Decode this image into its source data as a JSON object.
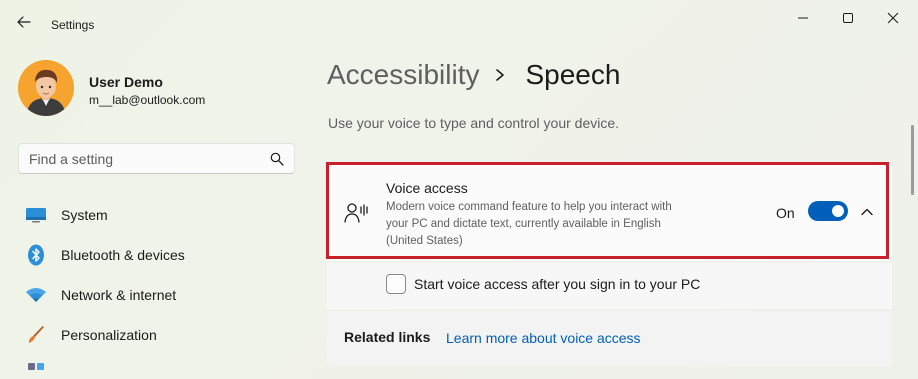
{
  "window": {
    "title": "Settings",
    "back_icon": "back-arrow-icon",
    "minimize_icon": "minimize-icon",
    "maximize_icon": "maximize-icon",
    "close_icon": "close-icon"
  },
  "user": {
    "name": "User Demo",
    "email": "m__lab@outlook.com"
  },
  "search": {
    "placeholder": "Find a setting",
    "icon": "search-icon"
  },
  "sidebar": {
    "items": [
      {
        "label": "System",
        "icon": "system-icon"
      },
      {
        "label": "Bluetooth & devices",
        "icon": "bluetooth-icon"
      },
      {
        "label": "Network & internet",
        "icon": "wifi-icon"
      },
      {
        "label": "Personalization",
        "icon": "brush-icon"
      }
    ]
  },
  "breadcrumb": {
    "parent": "Accessibility",
    "current": "Speech",
    "separator_icon": "chevron-right-icon"
  },
  "page": {
    "description": "Use your voice to type and control your device."
  },
  "voice_access": {
    "title": "Voice access",
    "description": "Modern voice command feature to help you interact with your PC and dictate text, currently available in English (United States)",
    "toggle_state": "On",
    "toggle_on": true,
    "icon": "voice-access-icon",
    "expand_icon": "chevron-up-icon"
  },
  "start_option": {
    "label": "Start voice access after you sign in to your PC",
    "checked": false
  },
  "related_links": {
    "title": "Related links",
    "link": "Learn more about voice access"
  },
  "colors": {
    "accent": "#005fb8",
    "highlight": "#c8202b"
  }
}
